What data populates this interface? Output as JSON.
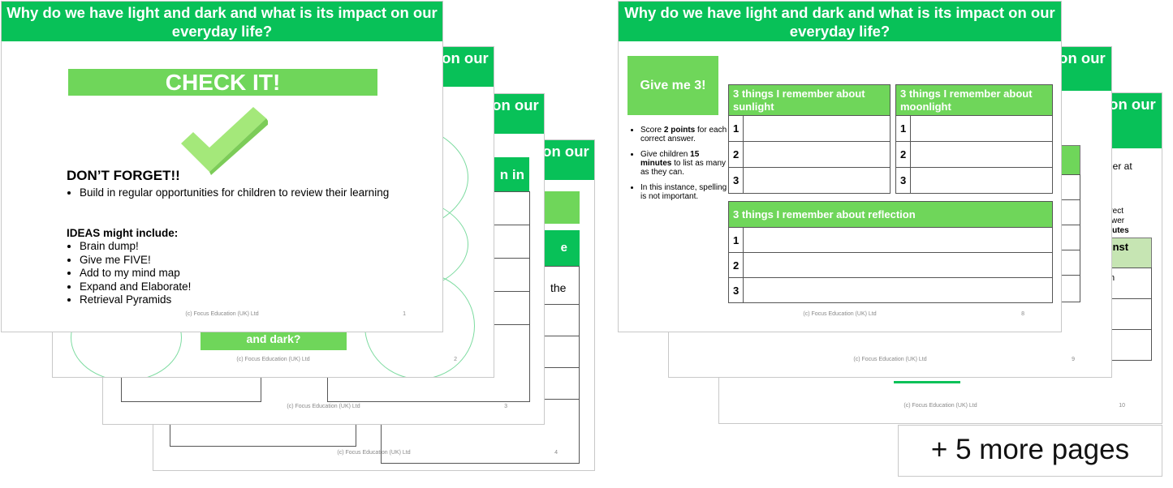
{
  "title": "Why do we have light and dark and what is its impact on our everyday life?",
  "footer": "(c) Focus Education (UK) Ltd",
  "colors": {
    "header_green": "#08c158",
    "accent_green": "#6fd65a",
    "light_green": "#c6e5b3"
  },
  "slide1": {
    "banner": "CHECK IT!",
    "icon": "checkmark-icon",
    "heading": "DON’T FORGET!!",
    "bullet": "Build in regular opportunities for children to review their learning",
    "ideas_heading": "IDEAS might include:",
    "ideas": [
      "Brain dump!",
      "Give me FIVE!",
      "Add to my mind map",
      "Expand and Elaborate!",
      "Retrieval Pyramids"
    ],
    "page": "1"
  },
  "slide2": {
    "box_text": "and dark?",
    "page": "2"
  },
  "slide3": {
    "header_fragment": "n in",
    "page": "3"
  },
  "slide4": {
    "box_fragment": ")",
    "header_fragment": "e",
    "text_fragment": "the",
    "page": "4"
  },
  "slide8": {
    "badge": "Give me 3!",
    "notes": [
      {
        "pre": "Score ",
        "bold": "2 points",
        "post": " for each correct answer."
      },
      {
        "pre": "Give children ",
        "bold": "15 minutes",
        "post": " to list as many as they can."
      },
      {
        "pre": "In this instance, spelling is not important.",
        "bold": "",
        "post": ""
      }
    ],
    "table_sunlight": "3 things I remember about sunlight",
    "table_moonlight": "3 things I remember about moonlight",
    "table_reflection": "3 things I remember about reflection",
    "row_numbers": [
      "1",
      "2",
      "3"
    ],
    "page": "8"
  },
  "slide9": {
    "page": "9"
  },
  "slide10": {
    "text1": "her at",
    "text2": "rrect",
    "text3": "swer",
    "text4": "nutes",
    "header_fragment": "inst",
    "row_fragment": "n",
    "page": "10"
  },
  "more_pages": "+ 5 more pages"
}
